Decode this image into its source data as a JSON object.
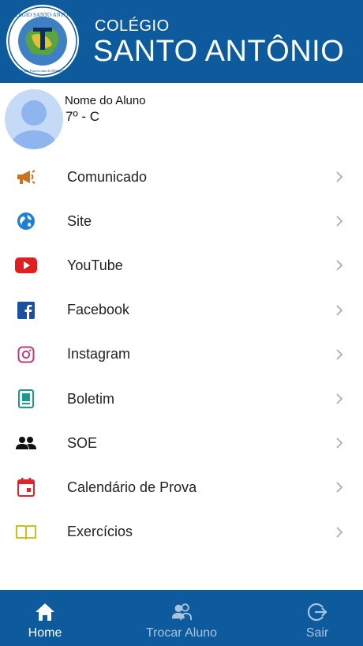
{
  "header": {
    "brand_small": "COLÉGIO",
    "brand_large": "SANTO ANTÔNIO",
    "logo_ring_text": "COLÉGIO SANTO ANTÔNIO",
    "logo_sub_text": "Irmãs Franciscanas de Dillingen",
    "colors": {
      "background": "#0d5a9c",
      "text": "#ffffff"
    }
  },
  "profile": {
    "name": "Nome do Aluno",
    "class": "7º - C"
  },
  "menu": {
    "items": [
      {
        "label": "Comunicado",
        "icon": "megaphone-icon",
        "color": "#c8741e"
      },
      {
        "label": "Site",
        "icon": "globe-icon",
        "color": "#1e7fd6"
      },
      {
        "label": "YouTube",
        "icon": "youtube-icon",
        "color": "#e01f1f"
      },
      {
        "label": "Facebook",
        "icon": "facebook-icon",
        "color": "#1d4fa0"
      },
      {
        "label": "Instagram",
        "icon": "instagram-icon",
        "color": "#c2387a"
      },
      {
        "label": "Boletim",
        "icon": "report-card-icon",
        "color": "#1a9a8a"
      },
      {
        "label": "SOE",
        "icon": "people-icon",
        "color": "#111111"
      },
      {
        "label": "Calendário de Prova",
        "icon": "calendar-icon",
        "color": "#e0242b"
      },
      {
        "label": "Exercícios",
        "icon": "open-book-icon",
        "color": "#c8c21a"
      }
    ]
  },
  "bottom_nav": {
    "home": {
      "label": "Home",
      "icon": "home-icon"
    },
    "trocar": {
      "label": "Trocar Aluno",
      "icon": "switch-user-icon"
    },
    "sair": {
      "label": "Sair",
      "icon": "logout-icon"
    },
    "colors": {
      "active": "#ffffff",
      "inactive": "#a8c3df"
    }
  }
}
